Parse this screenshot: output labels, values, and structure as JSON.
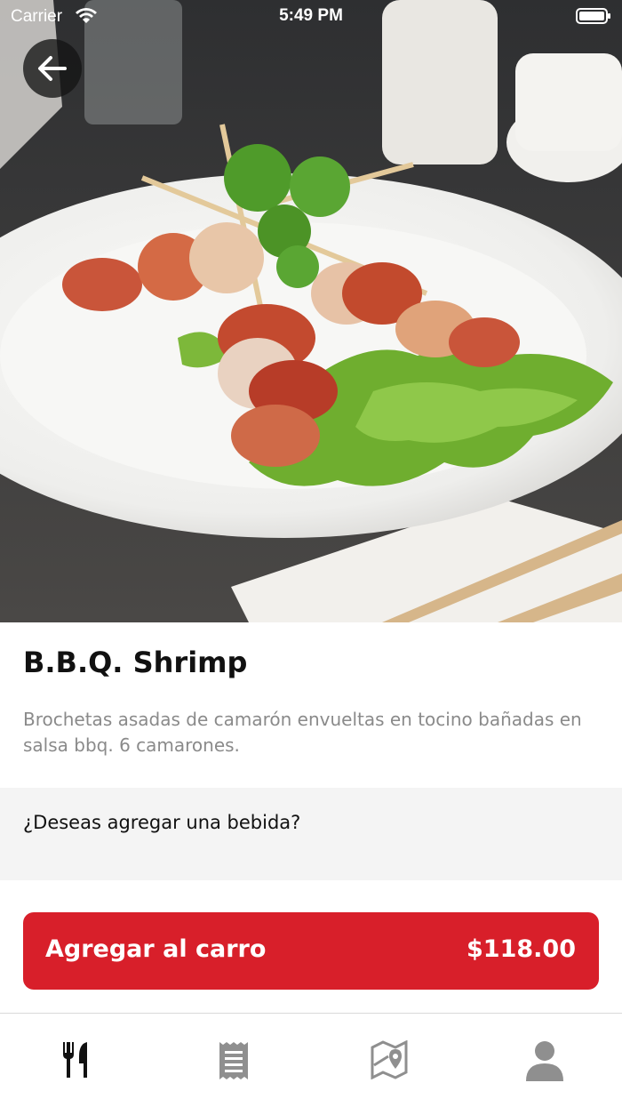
{
  "status_bar": {
    "carrier": "Carrier",
    "time": "5:49 PM"
  },
  "hero": {
    "image_alt": "B.B.Q. Shrimp dish photo"
  },
  "product": {
    "title": "B.B.Q. Shrimp",
    "description": "Brochetas asadas de camarón envueltas en tocino bañadas en salsa bbq. 6 camarones."
  },
  "drink": {
    "prompt": "¿Deseas agregar una bebida?"
  },
  "cart": {
    "label": "Agregar al carro",
    "price": "$118.00"
  },
  "tabbar": {
    "active_index": 0,
    "tabs": [
      {
        "icon": "fork-knife-icon"
      },
      {
        "icon": "receipt-icon"
      },
      {
        "icon": "map-pin-icon"
      },
      {
        "icon": "user-icon"
      }
    ]
  },
  "colors": {
    "accent": "#d81f2a",
    "drink_bg": "#f4f4f4",
    "desc_text": "#8a8a8a"
  }
}
